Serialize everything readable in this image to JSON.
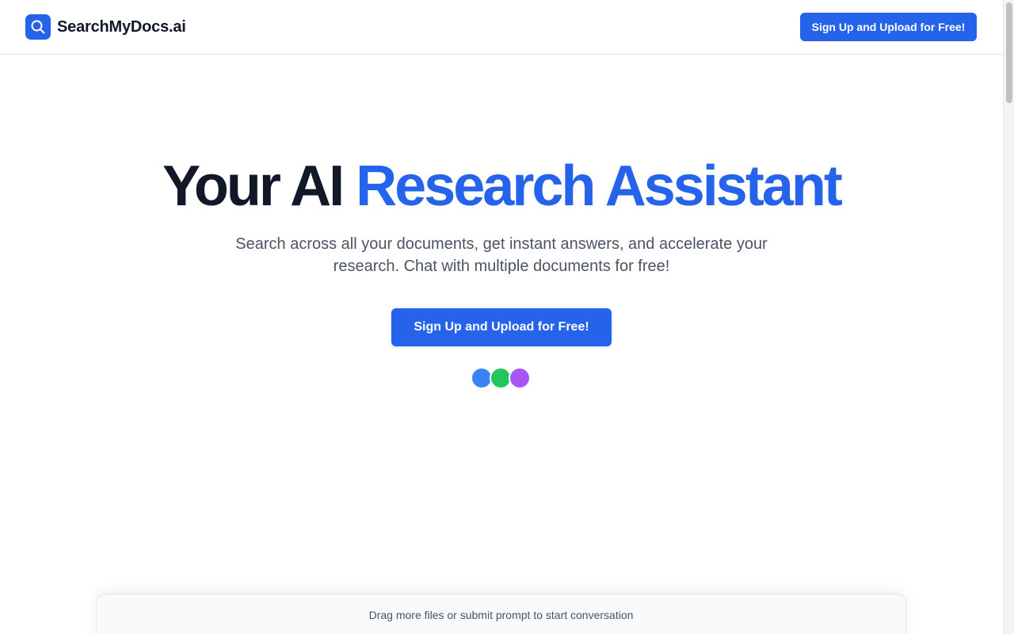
{
  "header": {
    "brand_name": "SearchMyDocs.ai",
    "brand_icon": "search-icon",
    "cta_label": "Sign Up and Upload for Free!"
  },
  "hero": {
    "title_plain": "Your AI ",
    "title_accent": "Research Assistant",
    "subtitle": "Search across all your documents, get instant answers, and accelerate your research. Chat with multiple documents for free!",
    "cta_label": "Sign Up and Upload for Free!",
    "avatar_colors": [
      "#3b82f6",
      "#22c55e",
      "#a855f7"
    ]
  },
  "dropzone": {
    "text": "Drag more files or submit prompt to start conversation"
  },
  "colors": {
    "accent": "#2563eb",
    "heading": "#111827",
    "muted": "#4b5563"
  }
}
